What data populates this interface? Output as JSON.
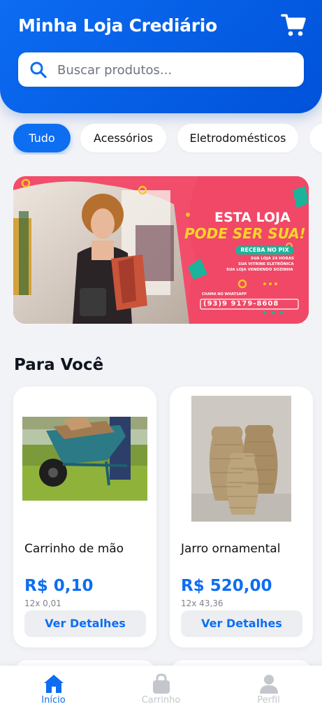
{
  "header": {
    "title": "Minha Loja Crediário",
    "cart_icon": "shopping-cart-icon",
    "search_icon": "search-icon",
    "search_placeholder": "Buscar produtos..."
  },
  "categories": [
    {
      "label": "Tudo",
      "active": true
    },
    {
      "label": "Acessórios",
      "active": false
    },
    {
      "label": "Eletrodomésticos",
      "active": false
    }
  ],
  "banner": {
    "headline_1": "ESTA LOJA",
    "headline_2": "PODE SER SUA!",
    "badge": "RECEBA NO PIX",
    "line_1": "SUA LOJA 24 HORAS",
    "line_2": "SUA VITRINE ELETRÔNICA",
    "line_3": "SUA LOJA VENDENDO SOZINHA",
    "whatsapp_label": "CHAMA NO WHATSAPP",
    "phone": "(93)9 9179-8608"
  },
  "section": {
    "title": "Para Você"
  },
  "products": [
    {
      "name": "Carrinho de mão",
      "price": "R$ 0,10",
      "installments": "12x 0,01",
      "button": "Ver Detalhes"
    },
    {
      "name": "Jarro ornamental",
      "price": "R$ 520,00",
      "installments": "12x 43,36",
      "button": "Ver Detalhes"
    }
  ],
  "nav": [
    {
      "label": "Início",
      "icon": "home-icon",
      "active": true
    },
    {
      "label": "Carrinho",
      "icon": "shopping-bag-icon",
      "active": false
    },
    {
      "label": "Perfil",
      "icon": "user-icon",
      "active": false
    }
  ],
  "colors": {
    "primary": "#0d6ef2",
    "background": "#f2f3f6",
    "banner": "#f24d6b"
  }
}
